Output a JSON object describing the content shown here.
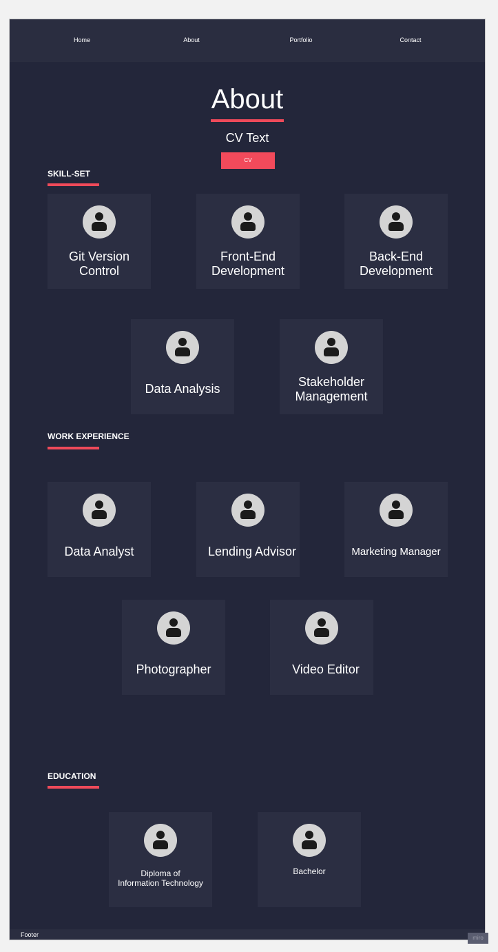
{
  "nav": {
    "items": [
      {
        "label": "Home"
      },
      {
        "label": "About"
      },
      {
        "label": "Portfolio"
      },
      {
        "label": "Contact"
      }
    ]
  },
  "hero": {
    "title": "About",
    "subtitle": "CV Text",
    "button_label": "CV"
  },
  "skills": {
    "title": "SKILL-SET",
    "cards": [
      {
        "label": "Git Version\nControl",
        "icon": "user-avatar-icon"
      },
      {
        "label": "Front-End\nDevelopment",
        "icon": "user-avatar-icon"
      },
      {
        "label": "Back-End\nDevelopment",
        "icon": "user-avatar-icon"
      },
      {
        "label": "Data Analysis",
        "icon": "user-avatar-icon"
      },
      {
        "label": "Stakeholder\nManagement",
        "icon": "user-avatar-icon"
      }
    ]
  },
  "work": {
    "title": "WORK EXPERIENCE",
    "cards": [
      {
        "label": "Data Analyst",
        "icon": "user-avatar-icon"
      },
      {
        "label": "Lending Advisor",
        "icon": "user-avatar-icon"
      },
      {
        "label": "Marketing Manager",
        "icon": "user-avatar-icon"
      },
      {
        "label": "Photographer",
        "icon": "user-avatar-icon"
      },
      {
        "label": "Video Editor",
        "icon": "user-avatar-icon"
      }
    ]
  },
  "education": {
    "title": "EDUCATION",
    "cards": [
      {
        "label": "Diploma of\nInformation Technology",
        "icon": "user-avatar-icon"
      },
      {
        "label": "Bachelor",
        "icon": "user-avatar-icon"
      }
    ]
  },
  "footer": {
    "text": "Footer"
  },
  "badge": {
    "text": "miro"
  },
  "colors": {
    "background": "#23263a",
    "nav": "#2a2d40",
    "card": "#2b2e42",
    "accent": "#ef4a5a",
    "avatar": "#d4d4d4"
  }
}
